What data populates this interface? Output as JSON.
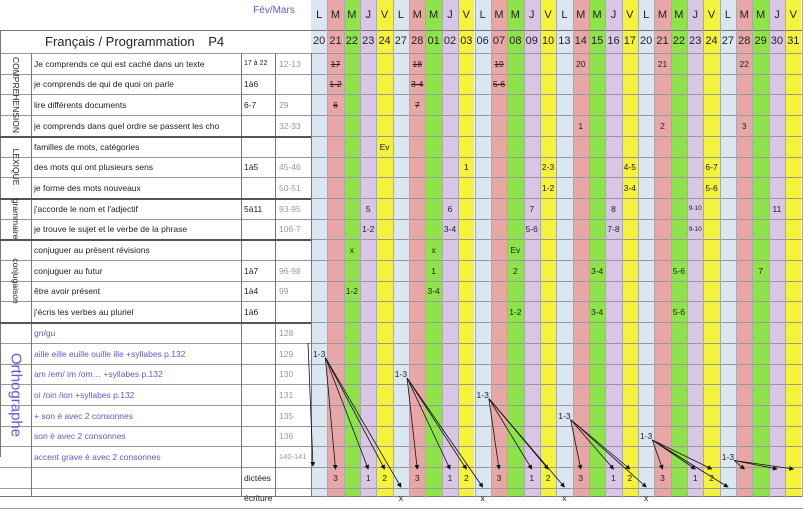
{
  "header": {
    "period": "Fév/Mars",
    "title": "Français / Programmation",
    "level": "P4"
  },
  "days": {
    "letters": [
      "L",
      "M",
      "M",
      "J",
      "V",
      "L",
      "M",
      "M",
      "J",
      "V",
      "L",
      "M",
      "M",
      "J",
      "V",
      "L",
      "M",
      "M",
      "J",
      "V",
      "L",
      "M",
      "M",
      "J",
      "V",
      "L",
      "M",
      "M",
      "J",
      "V"
    ],
    "dates": [
      "20",
      "21",
      "22",
      "23",
      "24",
      "27",
      "28",
      "01",
      "02",
      "03",
      "06",
      "07",
      "08",
      "09",
      "10",
      "13",
      "14",
      "15",
      "16",
      "17",
      "20",
      "21",
      "22",
      "23",
      "24",
      "27",
      "28",
      "29",
      "30",
      "31"
    ],
    "weekday_colors": {
      "L": "#dbe6f3",
      "M1": "#e8a6a6",
      "M2": "#8ee34a",
      "J": "#d9c5e6",
      "V": "#f4f23a"
    }
  },
  "sections": [
    {
      "label": "COMPREHENSION"
    },
    {
      "label": "LEXIQUE"
    },
    {
      "label": "grammaire"
    },
    {
      "label": "conjugaison"
    },
    {
      "label": "Orthographe"
    }
  ],
  "rows": [
    {
      "label": "Je comprends ce qui est caché dans un texte",
      "sessions": "17 à 22",
      "pages": "12-13"
    },
    {
      "label": "je comprends de qui de quoi on parle",
      "sessions": "1à6",
      "pages": ""
    },
    {
      "label": "lire différents documents",
      "sessions": "6-7",
      "pages": "29"
    },
    {
      "label": "je comprends dans quel ordre se passent les cho",
      "sessions": "",
      "pages": "32-33"
    },
    {
      "label": "familles de mots, catégories",
      "sessions": "",
      "pages": ""
    },
    {
      "label": "des mots qui ont plusieurs sens",
      "sessions": "1à5",
      "pages": "45-46"
    },
    {
      "label": "je forme des mots nouveaux",
      "sessions": "",
      "pages": "50-51"
    },
    {
      "label": "j'accorde le nom et l'adjectif",
      "sessions": "5à11",
      "pages": "93-95"
    },
    {
      "label": "je trouve le sujet et le verbe de la phrase",
      "sessions": "",
      "pages": "106-7"
    },
    {
      "label": "conjuguer au présent révisions",
      "sessions": "",
      "pages": ""
    },
    {
      "label": "conjuguer au futur",
      "sessions": "1à7",
      "pages": "96-98"
    },
    {
      "label": "être avoir présent",
      "sessions": "1à4",
      "pages": "99"
    },
    {
      "label": "j'écris les verbes au pluriel",
      "sessions": "1à6",
      "pages": ""
    },
    {
      "label": "gn/gu",
      "sessions": "",
      "pages": "128"
    },
    {
      "label": "aille eille euille ouille ille +syllabes p.132",
      "sessions": "",
      "pages": "129"
    },
    {
      "label": "am /em/ im /om… +syllabes p.132",
      "sessions": "",
      "pages": "130"
    },
    {
      "label": "oi /oin /ion +syllabes p.132",
      "sessions": "",
      "pages": "131"
    },
    {
      "label": "+ son é avec 2 consonnes",
      "sessions": "",
      "pages": "135"
    },
    {
      "label": "son è avec 2 consonnes",
      "sessions": "",
      "pages": "136"
    },
    {
      "label": "accent grave è avec 2 consonnes",
      "sessions": "",
      "pages": "140-141"
    }
  ],
  "footer_rows": [
    {
      "label": "dictées"
    },
    {
      "label": "écriture"
    }
  ],
  "marks": [
    {
      "row": 0,
      "day": 1,
      "text": "17",
      "struck": true
    },
    {
      "row": 0,
      "day": 6,
      "text": "18",
      "struck": true
    },
    {
      "row": 0,
      "day": 11,
      "text": "19",
      "struck": true
    },
    {
      "row": 0,
      "day": 16,
      "text": "20"
    },
    {
      "row": 0,
      "day": 21,
      "text": "21"
    },
    {
      "row": 0,
      "day": 26,
      "text": "22"
    },
    {
      "row": 1,
      "day": 1,
      "text": "1-2",
      "struck": true
    },
    {
      "row": 1,
      "day": 6,
      "text": "3-4",
      "struck": true
    },
    {
      "row": 1,
      "day": 11,
      "text": "5-6",
      "struck": true
    },
    {
      "row": 2,
      "day": 1,
      "text": "6",
      "struck": true
    },
    {
      "row": 2,
      "day": 6,
      "text": "7",
      "struck": true
    },
    {
      "row": 3,
      "day": 16,
      "text": "1"
    },
    {
      "row": 3,
      "day": 21,
      "text": "2"
    },
    {
      "row": 3,
      "day": 26,
      "text": "3"
    },
    {
      "row": 4,
      "day": 4,
      "text": "Ev"
    },
    {
      "row": 5,
      "day": 9,
      "text": "1"
    },
    {
      "row": 5,
      "day": 14,
      "text": "2-3"
    },
    {
      "row": 5,
      "day": 19,
      "text": "4-5"
    },
    {
      "row": 5,
      "day": 24,
      "text": "6-7"
    },
    {
      "row": 6,
      "day": 14,
      "text": "1-2"
    },
    {
      "row": 6,
      "day": 19,
      "text": "3-4"
    },
    {
      "row": 6,
      "day": 24,
      "text": "5-6"
    },
    {
      "row": 7,
      "day": 3,
      "text": "5"
    },
    {
      "row": 7,
      "day": 8,
      "text": "6"
    },
    {
      "row": 7,
      "day": 13,
      "text": "7"
    },
    {
      "row": 7,
      "day": 18,
      "text": "8"
    },
    {
      "row": 7,
      "day": 23,
      "text": "9-10",
      "small": true
    },
    {
      "row": 7,
      "day": 28,
      "text": "11"
    },
    {
      "row": 8,
      "day": 3,
      "text": "1-2"
    },
    {
      "row": 8,
      "day": 8,
      "text": "3-4"
    },
    {
      "row": 8,
      "day": 13,
      "text": "5-6"
    },
    {
      "row": 8,
      "day": 18,
      "text": "7-8"
    },
    {
      "row": 8,
      "day": 23,
      "text": "9-10",
      "small": true
    },
    {
      "row": 9,
      "day": 2,
      "text": "x"
    },
    {
      "row": 9,
      "day": 7,
      "text": "x"
    },
    {
      "row": 9,
      "day": 12,
      "text": "Ev"
    },
    {
      "row": 10,
      "day": 7,
      "text": "1"
    },
    {
      "row": 10,
      "day": 12,
      "text": "2"
    },
    {
      "row": 10,
      "day": 17,
      "text": "3-4"
    },
    {
      "row": 10,
      "day": 22,
      "text": "5-6"
    },
    {
      "row": 10,
      "day": 27,
      "text": "7"
    },
    {
      "row": 11,
      "day": 2,
      "text": "1-2"
    },
    {
      "row": 11,
      "day": 7,
      "text": "3-4"
    },
    {
      "row": 12,
      "day": 12,
      "text": "1-2"
    },
    {
      "row": 12,
      "day": 17,
      "text": "3-4"
    },
    {
      "row": 12,
      "day": 22,
      "text": "5-6"
    },
    {
      "row": 14,
      "day": 0,
      "text": "1-3"
    },
    {
      "row": 15,
      "day": 5,
      "text": "1-3"
    },
    {
      "row": 16,
      "day": 10,
      "text": "1-3"
    },
    {
      "row": 17,
      "day": 15,
      "text": "1-3"
    },
    {
      "row": 18,
      "day": 20,
      "text": "1-3"
    },
    {
      "row": 19,
      "day": 25,
      "text": "1-3"
    },
    {
      "row": 20,
      "day": 1,
      "text": "3"
    },
    {
      "row": 20,
      "day": 3,
      "text": "1"
    },
    {
      "row": 20,
      "day": 4,
      "text": "2"
    },
    {
      "row": 20,
      "day": 6,
      "text": "3"
    },
    {
      "row": 20,
      "day": 8,
      "text": "1"
    },
    {
      "row": 20,
      "day": 9,
      "text": "2"
    },
    {
      "row": 20,
      "day": 11,
      "text": "3"
    },
    {
      "row": 20,
      "day": 13,
      "text": "1"
    },
    {
      "row": 20,
      "day": 14,
      "text": "2"
    },
    {
      "row": 20,
      "day": 16,
      "text": "3"
    },
    {
      "row": 20,
      "day": 18,
      "text": "1"
    },
    {
      "row": 20,
      "day": 19,
      "text": "2"
    },
    {
      "row": 20,
      "day": 21,
      "text": "3"
    },
    {
      "row": 20,
      "day": 23,
      "text": "1"
    },
    {
      "row": 20,
      "day": 24,
      "text": "2"
    },
    {
      "row": 21,
      "day": 5,
      "text": "x"
    },
    {
      "row": 21,
      "day": 10,
      "text": "x"
    },
    {
      "row": 21,
      "day": 15,
      "text": "x"
    },
    {
      "row": 21,
      "day": 20,
      "text": "x"
    }
  ]
}
